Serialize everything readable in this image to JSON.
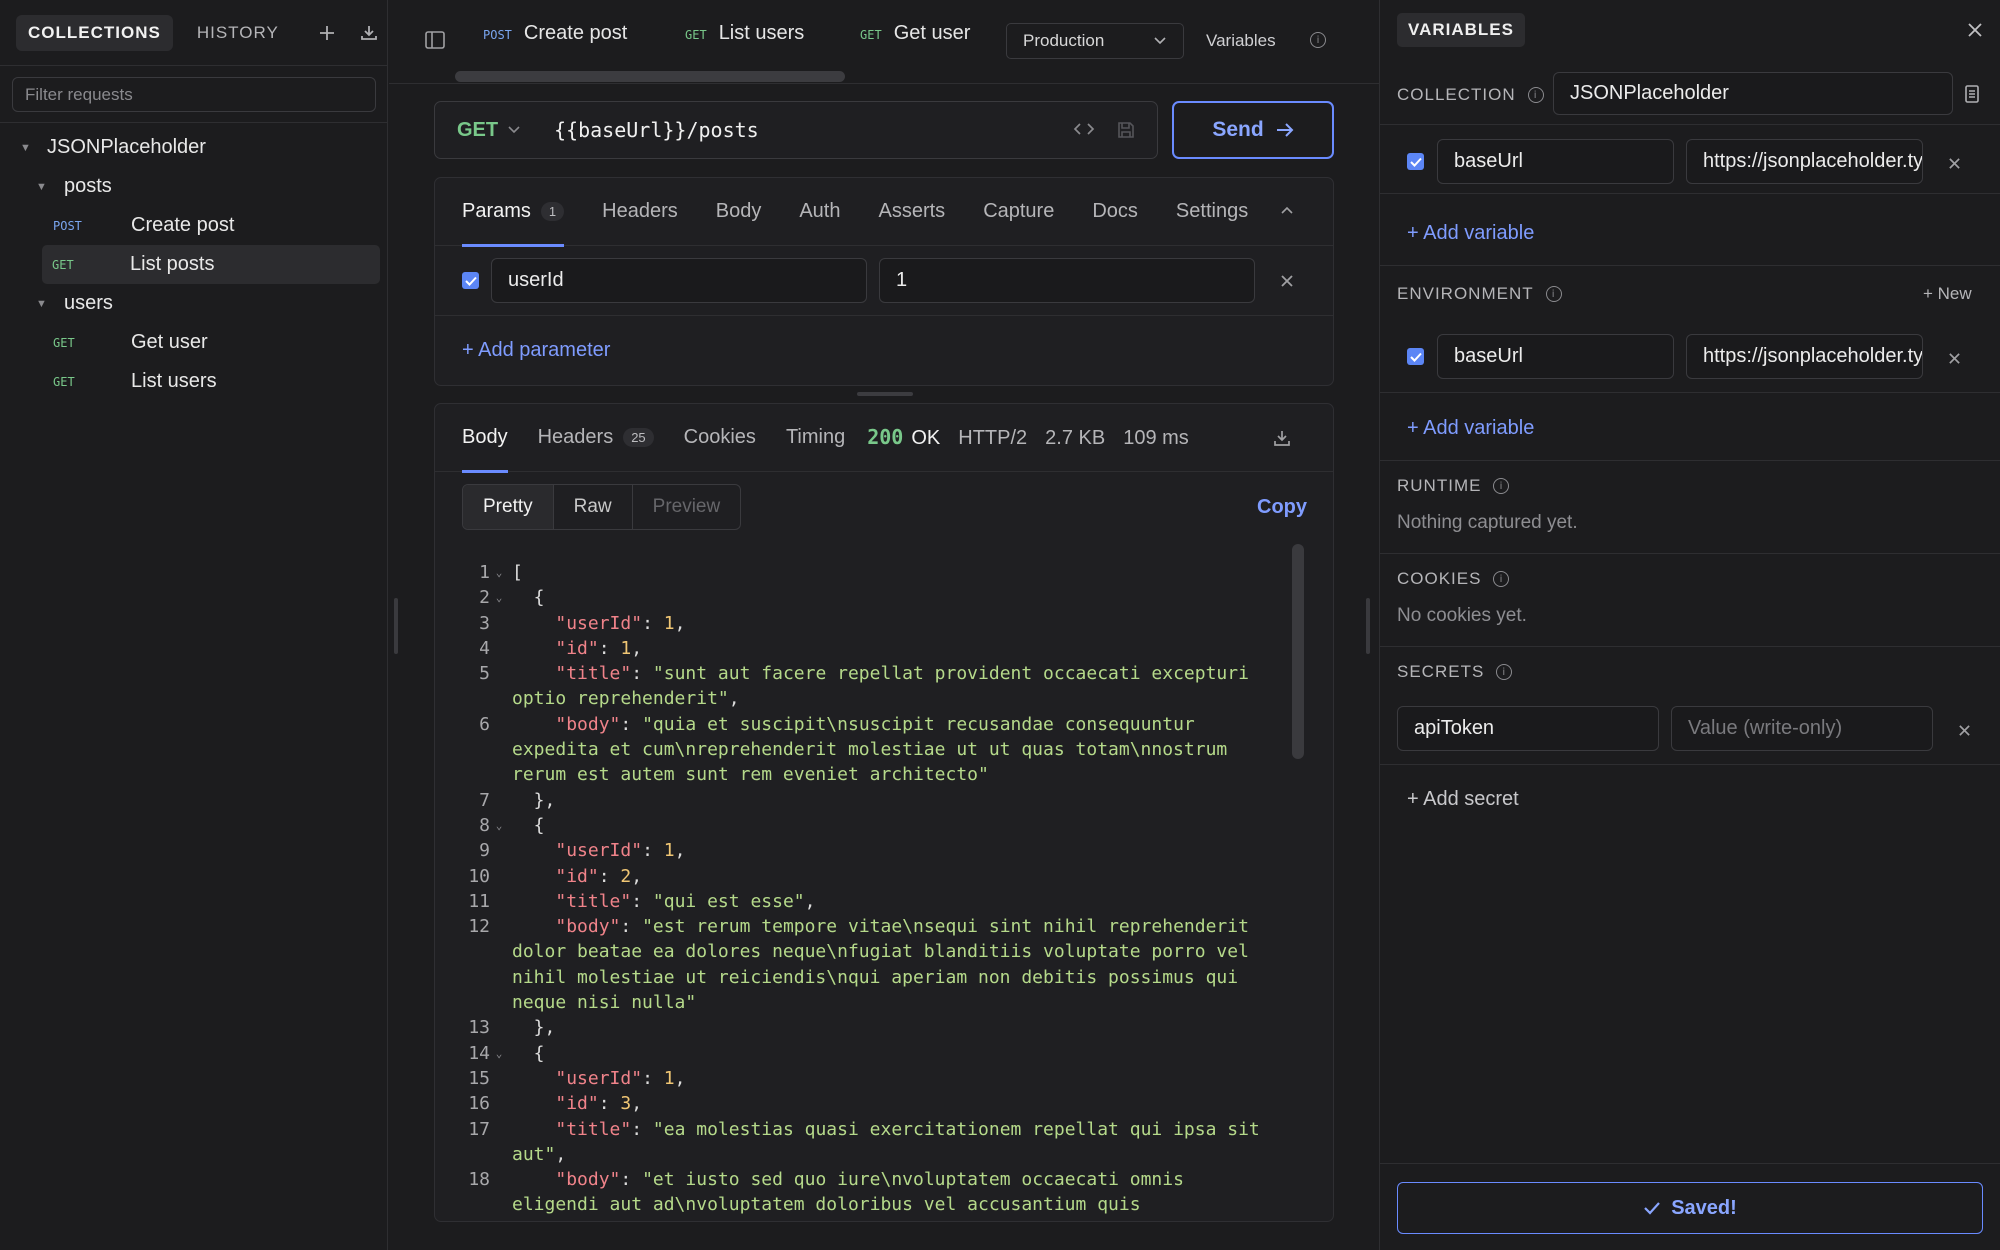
{
  "sidebar": {
    "tabs": [
      "COLLECTIONS",
      "HISTORY"
    ],
    "filter_placeholder": "Filter requests",
    "tree": {
      "collection": "JSONPlaceholder",
      "folders": [
        {
          "name": "posts",
          "items": [
            {
              "method": "POST",
              "name": "Create post"
            },
            {
              "method": "GET",
              "name": "List posts"
            }
          ]
        },
        {
          "name": "users",
          "items": [
            {
              "method": "GET",
              "name": "Get user"
            },
            {
              "method": "GET",
              "name": "List users"
            }
          ]
        }
      ]
    }
  },
  "tabs": [
    {
      "method": "POST",
      "name": "Create post"
    },
    {
      "method": "GET",
      "name": "List users"
    },
    {
      "method": "GET",
      "name": "Get user"
    }
  ],
  "environment": {
    "selected": "Production",
    "variables_label": "Variables"
  },
  "request": {
    "method": "GET",
    "url": "{{baseUrl}}/posts",
    "send_label": "Send"
  },
  "request_tabs": {
    "params": "Params",
    "params_count": "1",
    "headers": "Headers",
    "body": "Body",
    "auth": "Auth",
    "asserts": "Asserts",
    "capture": "Capture",
    "docs": "Docs",
    "settings": "Settings"
  },
  "params": [
    {
      "key": "userId",
      "value": "1"
    }
  ],
  "add_parameter": "+ Add parameter",
  "response": {
    "tabs": {
      "body": "Body",
      "headers": "Headers",
      "headers_count": "25",
      "cookies": "Cookies",
      "timing": "Timing"
    },
    "status_code": "200",
    "status_text": "OK",
    "protocol": "HTTP/2",
    "size": "2.7 KB",
    "time": "109 ms",
    "views": [
      "Pretty",
      "Raw",
      "Preview"
    ],
    "copy_label": "Copy",
    "lines": [
      {
        "n": "1",
        "fold": true,
        "parts": [
          [
            "p",
            "["
          ]
        ]
      },
      {
        "n": "2",
        "fold": true,
        "parts": [
          [
            "p",
            "  {"
          ]
        ]
      },
      {
        "n": "3",
        "parts": [
          [
            "p",
            "    "
          ],
          [
            "k",
            "\"userId\""
          ],
          [
            "p",
            ": "
          ],
          [
            "n",
            "1"
          ],
          [
            "p",
            ","
          ]
        ]
      },
      {
        "n": "4",
        "parts": [
          [
            "p",
            "    "
          ],
          [
            "k",
            "\"id\""
          ],
          [
            "p",
            ": "
          ],
          [
            "n",
            "1"
          ],
          [
            "p",
            ","
          ]
        ]
      },
      {
        "n": "5",
        "parts": [
          [
            "p",
            "    "
          ],
          [
            "k",
            "\"title\""
          ],
          [
            "p",
            ": "
          ],
          [
            "s",
            "\"sunt aut facere repellat provident occaecati excepturi"
          ]
        ]
      },
      {
        "n": "",
        "parts": [
          [
            "s",
            "optio reprehenderit\""
          ],
          [
            "p",
            ","
          ]
        ]
      },
      {
        "n": "6",
        "parts": [
          [
            "p",
            "    "
          ],
          [
            "k",
            "\"body\""
          ],
          [
            "p",
            ": "
          ],
          [
            "s",
            "\"quia et suscipit\\nsuscipit recusandae consequuntur"
          ]
        ]
      },
      {
        "n": "",
        "parts": [
          [
            "s",
            "expedita et cum\\nreprehenderit molestiae ut ut quas totam\\nnostrum"
          ]
        ]
      },
      {
        "n": "",
        "parts": [
          [
            "s",
            "rerum est autem sunt rem eveniet architecto\""
          ]
        ]
      },
      {
        "n": "7",
        "parts": [
          [
            "p",
            "  },"
          ]
        ]
      },
      {
        "n": "8",
        "fold": true,
        "parts": [
          [
            "p",
            "  {"
          ]
        ]
      },
      {
        "n": "9",
        "parts": [
          [
            "p",
            "    "
          ],
          [
            "k",
            "\"userId\""
          ],
          [
            "p",
            ": "
          ],
          [
            "n",
            "1"
          ],
          [
            "p",
            ","
          ]
        ]
      },
      {
        "n": "10",
        "parts": [
          [
            "p",
            "    "
          ],
          [
            "k",
            "\"id\""
          ],
          [
            "p",
            ": "
          ],
          [
            "n",
            "2"
          ],
          [
            "p",
            ","
          ]
        ]
      },
      {
        "n": "11",
        "parts": [
          [
            "p",
            "    "
          ],
          [
            "k",
            "\"title\""
          ],
          [
            "p",
            ": "
          ],
          [
            "s",
            "\"qui est esse\""
          ],
          [
            "p",
            ","
          ]
        ]
      },
      {
        "n": "12",
        "parts": [
          [
            "p",
            "    "
          ],
          [
            "k",
            "\"body\""
          ],
          [
            "p",
            ": "
          ],
          [
            "s",
            "\"est rerum tempore vitae\\nsequi sint nihil reprehenderit"
          ]
        ]
      },
      {
        "n": "",
        "parts": [
          [
            "s",
            "dolor beatae ea dolores neque\\nfugiat blanditiis voluptate porro vel"
          ]
        ]
      },
      {
        "n": "",
        "parts": [
          [
            "s",
            "nihil molestiae ut reiciendis\\nqui aperiam non debitis possimus qui"
          ]
        ]
      },
      {
        "n": "",
        "parts": [
          [
            "s",
            "neque nisi nulla\""
          ]
        ]
      },
      {
        "n": "13",
        "parts": [
          [
            "p",
            "  },"
          ]
        ]
      },
      {
        "n": "14",
        "fold": true,
        "parts": [
          [
            "p",
            "  {"
          ]
        ]
      },
      {
        "n": "15",
        "parts": [
          [
            "p",
            "    "
          ],
          [
            "k",
            "\"userId\""
          ],
          [
            "p",
            ": "
          ],
          [
            "n",
            "1"
          ],
          [
            "p",
            ","
          ]
        ]
      },
      {
        "n": "16",
        "parts": [
          [
            "p",
            "    "
          ],
          [
            "k",
            "\"id\""
          ],
          [
            "p",
            ": "
          ],
          [
            "n",
            "3"
          ],
          [
            "p",
            ","
          ]
        ]
      },
      {
        "n": "17",
        "parts": [
          [
            "p",
            "    "
          ],
          [
            "k",
            "\"title\""
          ],
          [
            "p",
            ": "
          ],
          [
            "s",
            "\"ea molestias quasi exercitationem repellat qui ipsa sit"
          ]
        ]
      },
      {
        "n": "",
        "parts": [
          [
            "s",
            "aut\""
          ],
          [
            "p",
            ","
          ]
        ]
      },
      {
        "n": "18",
        "parts": [
          [
            "p",
            "    "
          ],
          [
            "k",
            "\"body\""
          ],
          [
            "p",
            ": "
          ],
          [
            "s",
            "\"et iusto sed quo iure\\nvoluptatem occaecati omnis"
          ]
        ]
      },
      {
        "n": "",
        "parts": [
          [
            "s",
            "eligendi aut ad\\nvoluptatem doloribus vel accusantium quis"
          ]
        ]
      }
    ]
  },
  "variables_panel": {
    "title": "VARIABLES",
    "collection": {
      "label": "COLLECTION",
      "name": "JSONPlaceholder",
      "vars": [
        {
          "key": "baseUrl",
          "value": "https://jsonplaceholder.typicode.com"
        }
      ],
      "add_label": "+ Add variable"
    },
    "environment": {
      "label": "ENVIRONMENT",
      "new_label": "+ New",
      "vars": [
        {
          "key": "baseUrl",
          "value": "https://jsonplaceholder.typicode.com"
        }
      ],
      "add_label": "+ Add variable"
    },
    "runtime": {
      "label": "RUNTIME",
      "empty": "Nothing captured yet."
    },
    "cookies": {
      "label": "COOKIES",
      "empty": "No cookies yet."
    },
    "secrets": {
      "label": "SECRETS",
      "key": "apiToken",
      "value_placeholder": "Value (write-only)",
      "add_label": "+ Add secret"
    },
    "saved_label": "Saved!"
  }
}
